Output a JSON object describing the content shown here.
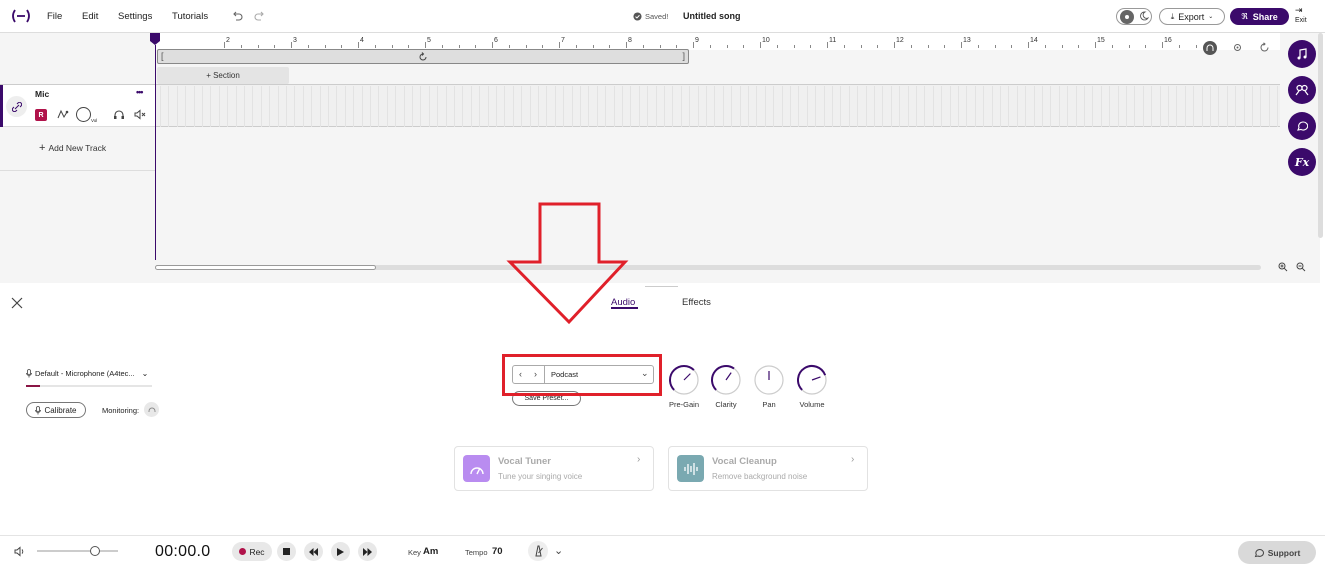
{
  "topbar": {
    "menu": [
      "File",
      "Edit",
      "Settings",
      "Tutorials"
    ],
    "saved_label": "Saved!",
    "song_title": "Untitled song",
    "export_label": "Export",
    "share_label": "Share",
    "exit_label": "Exit"
  },
  "ruler": {
    "marks": [
      "2",
      "3",
      "4",
      "5",
      "6",
      "7",
      "8",
      "9",
      "10",
      "11",
      "12",
      "13",
      "14",
      "15",
      "16"
    ]
  },
  "timeline": {
    "section_label": "+ Section"
  },
  "track": {
    "name": "Mic",
    "more_label": "•••",
    "rec_label": "R",
    "vol_label": "Vol",
    "add_track_label": "Add New Track"
  },
  "panel": {
    "tabs": [
      "Audio",
      "Effects"
    ],
    "active_tab": "Audio",
    "input_device": "Default - Microphone (A4tec...",
    "calibrate_label": "Calibrate",
    "monitoring_label": "Monitoring:",
    "preset_value": "Podcast",
    "save_preset_label": "Save Preset...",
    "knobs": [
      "Pre-Gain",
      "Clarity",
      "Pan",
      "Volume"
    ],
    "cards": [
      {
        "title": "Vocal Tuner",
        "subtitle": "Tune your singing voice"
      },
      {
        "title": "Vocal Cleanup",
        "subtitle": "Remove background noise"
      }
    ]
  },
  "transport": {
    "time": "00:00.0",
    "rec_label": "Rec",
    "key_label": "Key",
    "key_value": "Am",
    "tempo_label": "Tempo",
    "tempo_value": "70",
    "support_label": "Support"
  },
  "colors": {
    "accent": "#3b0a6b",
    "highlight_box": "#e0202a",
    "arrow": "#e0202a",
    "vocal_tuner_icon": "#b98cf0",
    "vocal_cleanup_icon": "#7aa9b1"
  },
  "icons": [
    "logo-icon",
    "undo-icon",
    "redo-icon",
    "check-circle-icon",
    "theme-toggle-icon",
    "export-icon",
    "share-icon",
    "exit-icon",
    "music-note-icon",
    "collab-icon",
    "chat-icon",
    "fx-icon",
    "loop-icon",
    "link-icon",
    "headphones-icon",
    "mute-icon",
    "close-icon",
    "microphone-icon",
    "zoom-in-icon",
    "zoom-out-icon",
    "volume-icon",
    "stop-icon",
    "rewind-icon",
    "play-icon",
    "forward-icon",
    "metronome-icon",
    "chevron-down-icon"
  ]
}
